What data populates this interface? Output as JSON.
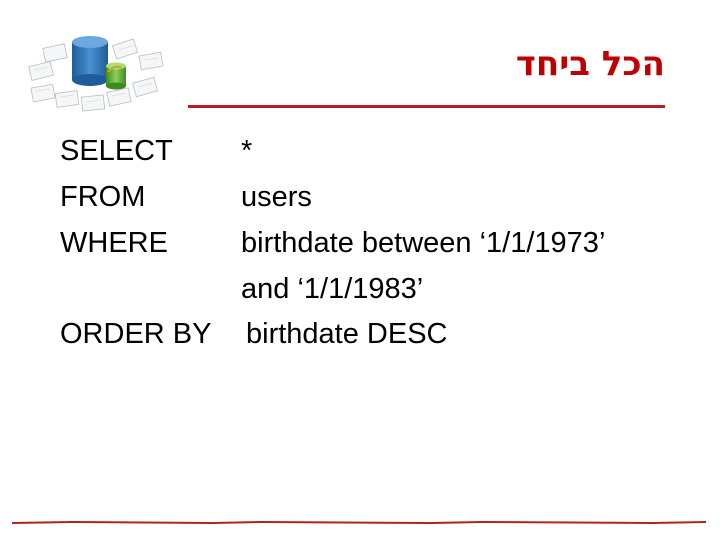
{
  "slide": {
    "title": "הכל ביחד"
  },
  "query": {
    "lines": [
      {
        "keyword": "SELECT",
        "value": "*"
      },
      {
        "keyword": "FROM",
        "value": "users"
      },
      {
        "keyword": "WHERE",
        "value": "birthdate between ‘1/1/1973’"
      },
      {
        "keyword": "",
        "value": "and ‘1/1/1983’"
      },
      {
        "keyword": "ORDER BY",
        "value": "birthdate DESC"
      }
    ]
  },
  "colors": {
    "title": "#c00000",
    "rule": "#b22222",
    "db_blue": "#2a6fb0",
    "db_green": "#5aa832"
  },
  "icons": {
    "logo": "database-icon"
  }
}
